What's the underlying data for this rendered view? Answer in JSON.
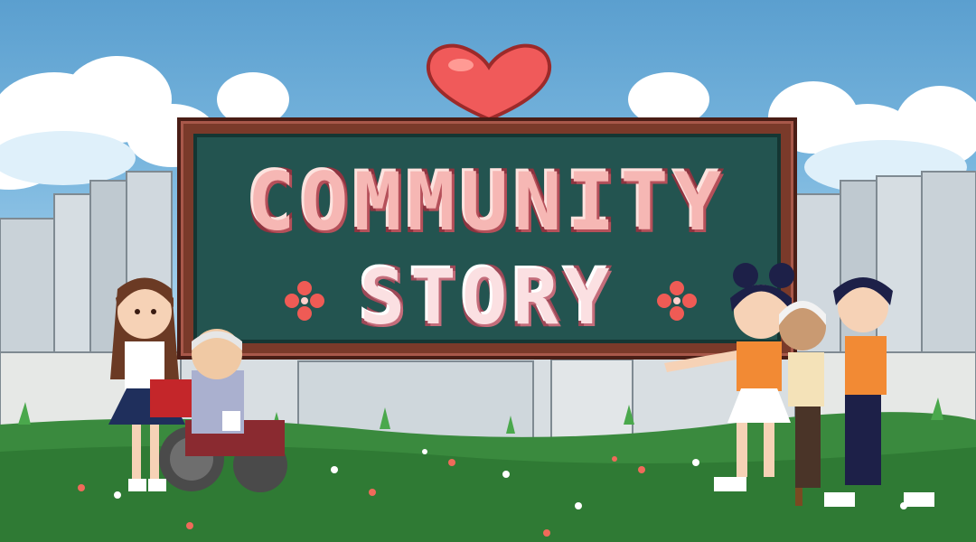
{
  "title": {
    "line1": "COMMUNITY",
    "line2": "STORY"
  },
  "colors": {
    "sky": "#79b6de",
    "grass": "#3a8a3e",
    "sign_board": "#235450",
    "sign_frame": "#7a3a2a",
    "title_pink": "#f6b7b4",
    "heart": "#f05a5a"
  },
  "icons": [
    "heart-icon",
    "flower-ornament-icon"
  ]
}
